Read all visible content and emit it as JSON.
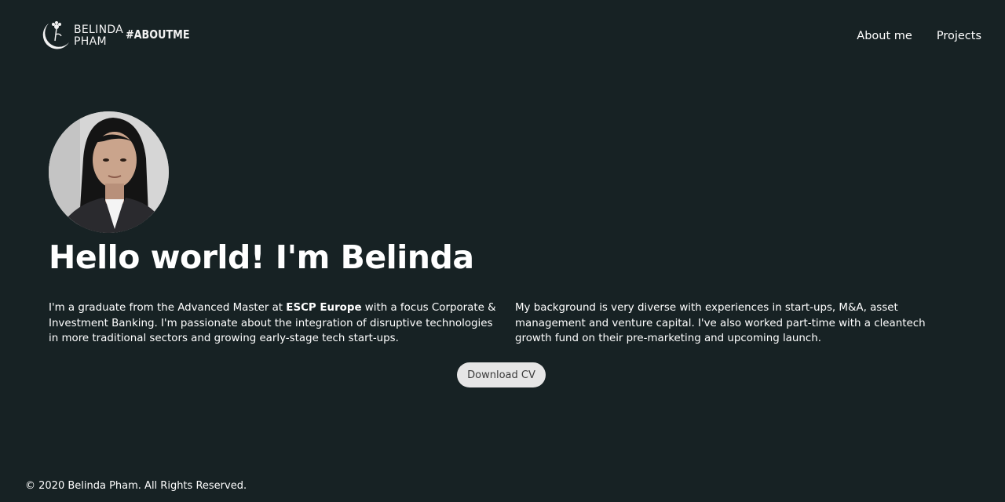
{
  "header": {
    "logo": {
      "line1": "BELINDA",
      "line2": "PHAM"
    },
    "tagline": "#ABOUTME",
    "nav": [
      {
        "label": "About me"
      },
      {
        "label": "Projects"
      }
    ]
  },
  "hero": {
    "title": "Hello world! I'm Belinda",
    "avatar_alt": "profile photo"
  },
  "about": {
    "left": {
      "before": "I'm a graduate from the Advanced Master at ",
      "bold": "ESCP Europe",
      "after": " with a focus Corporate & Investment Banking. I'm passionate about the integration of disruptive technologies in more traditional sectors and growing early-stage tech start-ups."
    },
    "right": "My background is very diverse with experiences in start-ups, M&A, asset management and venture capital. I've also worked part-time with a cleantech growth fund on their pre-marketing and upcoming launch."
  },
  "cv_button": "Download CV",
  "footer": "© 2020 Belinda Pham. All Rights Reserved.",
  "colors": {
    "background": "#172224",
    "text": "#ffffff",
    "button_bg": "#e6e6e6",
    "button_text": "#3a3a3a"
  }
}
